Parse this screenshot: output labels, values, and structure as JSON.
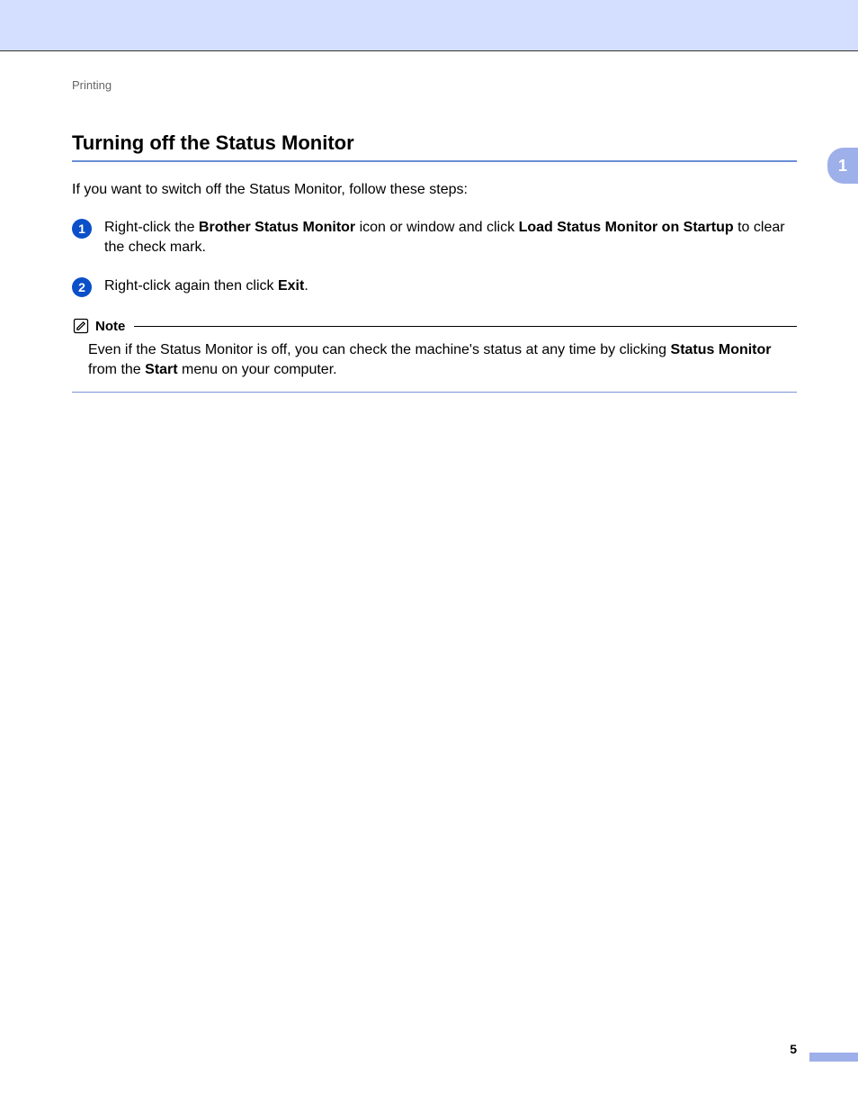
{
  "header": {
    "breadcrumb": "Printing",
    "chapter_tab": "1"
  },
  "section": {
    "title": "Turning off the Status Monitor",
    "intro": "If you want to switch off the Status Monitor, follow these steps:",
    "steps": [
      {
        "num": "1",
        "pre": "Right-click the ",
        "bold1": "Brother Status Monitor",
        "mid": " icon or window and click ",
        "bold2": "Load Status Monitor on Startup",
        "post": " to clear the check mark."
      },
      {
        "num": "2",
        "pre": "Right-click again then click ",
        "bold1": "Exit",
        "mid": "",
        "bold2": "",
        "post": "."
      }
    ],
    "note": {
      "label": "Note",
      "pre": "Even if the Status Monitor is off, you can check the machine's status at any time by clicking ",
      "bold1": "Status Monitor",
      "mid": " from the ",
      "bold2": "Start",
      "post": " menu on your computer."
    }
  },
  "footer": {
    "page": "5"
  }
}
